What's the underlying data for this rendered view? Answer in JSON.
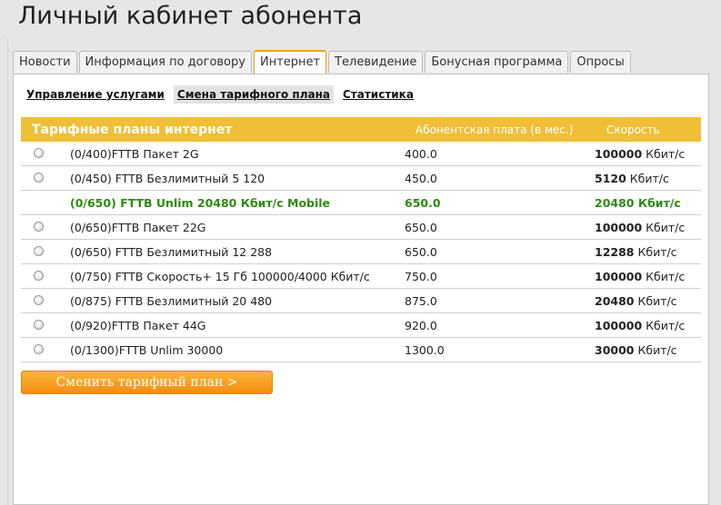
{
  "page_title": "Личный кабинет абонента",
  "tabs": [
    {
      "label": "Новости",
      "active": false
    },
    {
      "label": "Информация по договору",
      "active": false
    },
    {
      "label": "Интернет",
      "active": true
    },
    {
      "label": "Телевидение",
      "active": false
    },
    {
      "label": "Бонусная программа",
      "active": false
    },
    {
      "label": "Опросы",
      "active": false
    }
  ],
  "subnav": [
    {
      "label": "Управление услугами",
      "active": false
    },
    {
      "label": "Смена тарифного плана",
      "active": true
    },
    {
      "label": "Статистика",
      "active": false
    }
  ],
  "table": {
    "headers": {
      "name": "Тарифные планы интернет",
      "fee": "Абонентская плата (в мес.)",
      "speed": "Скорость"
    },
    "rows": [
      {
        "name": "(0/400)FTTB Пакет 2G",
        "fee": "400.0",
        "speed_value": "100000",
        "speed_unit": "Кбит/с",
        "current": false
      },
      {
        "name": "(0/450) FTTB Безлимитный 5 120",
        "fee": "450.0",
        "speed_value": "5120",
        "speed_unit": "Кбит/с",
        "current": false
      },
      {
        "name": "(0/650) FTTB Unlim 20480 Кбит/с Mobile",
        "fee": "650.0",
        "speed_value": "20480",
        "speed_unit": "Кбит/с",
        "current": true
      },
      {
        "name": "(0/650)FTTB Пакет 22G",
        "fee": "650.0",
        "speed_value": "100000",
        "speed_unit": "Кбит/с",
        "current": false
      },
      {
        "name": "(0/650) FTTB Безлимитный 12 288",
        "fee": "650.0",
        "speed_value": "12288",
        "speed_unit": "Кбит/с",
        "current": false
      },
      {
        "name": "(0/750) FTTB Скорость+ 15 Гб 100000/4000 Кбит/с",
        "fee": "750.0",
        "speed_value": "100000",
        "speed_unit": "Кбит/с",
        "current": false
      },
      {
        "name": "(0/875) FTTB Безлимитный 20 480",
        "fee": "875.0",
        "speed_value": "20480",
        "speed_unit": "Кбит/с",
        "current": false
      },
      {
        "name": "(0/920)FTTB Пакет 44G",
        "fee": "920.0",
        "speed_value": "100000",
        "speed_unit": "Кбит/с",
        "current": false
      },
      {
        "name": "(0/1300)FTTB Unlim 30000",
        "fee": "1300.0",
        "speed_value": "30000",
        "speed_unit": "Кбит/с",
        "current": false
      }
    ]
  },
  "submit_label": "Сменить тарифный план >",
  "colors": {
    "accent": "#f0be37",
    "current_plan": "#2d8a13",
    "button": "#f7a023"
  }
}
